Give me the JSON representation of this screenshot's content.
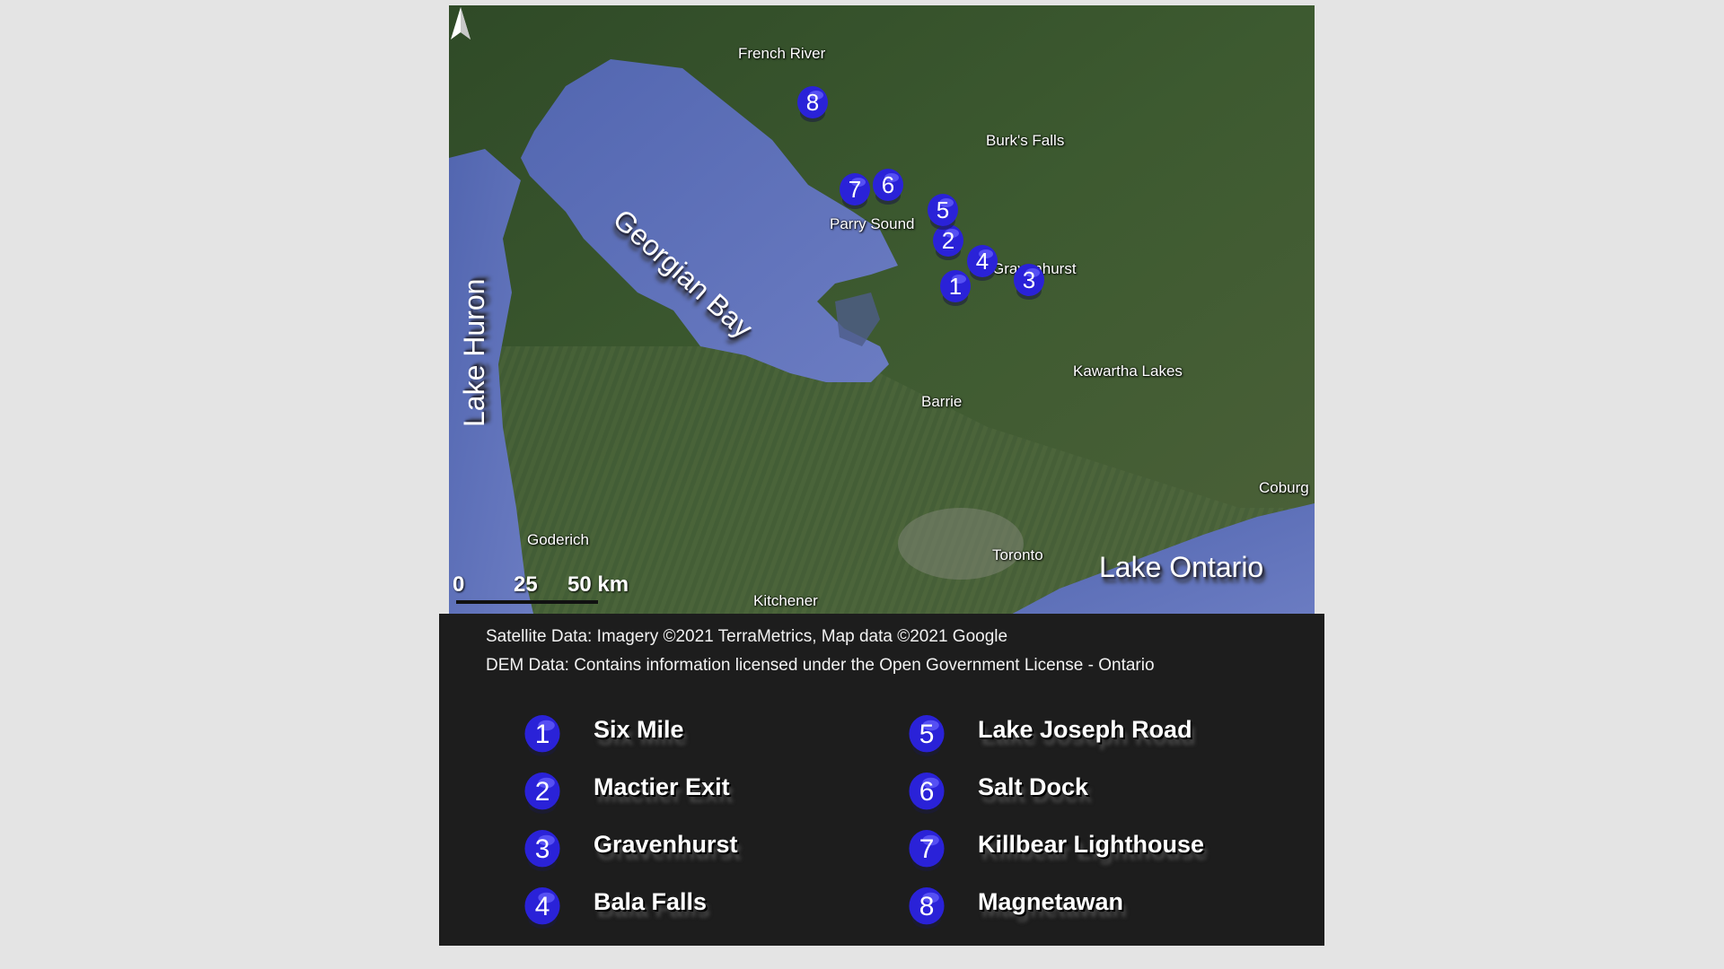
{
  "map": {
    "water_labels": {
      "georgian_bay": "Georgian Bay",
      "lake_huron": "Lake Huron",
      "lake_ontario": "Lake Ontario"
    },
    "place_labels": {
      "french_river": "French River",
      "burks_falls": "Burk's Falls",
      "parry_sound": "Parry Sound",
      "gravenhurst": "Gravenhurst",
      "kawartha_lakes": "Kawartha Lakes",
      "barrie": "Barrie",
      "coburg": "Coburg",
      "goderich": "Goderich",
      "toronto": "Toronto",
      "kitchener": "Kitchener"
    },
    "scale_bar": {
      "zero": "0",
      "mid": "25",
      "end": "50 km"
    },
    "north_arrow_icon": "north-arrow-icon",
    "colors": {
      "water": "#5a6fb8",
      "land": "#3f5b31",
      "pin": "#2a22d8",
      "legend_bg": "#1d1d1d"
    },
    "pins": [
      {
        "number": "1"
      },
      {
        "number": "2"
      },
      {
        "number": "3"
      },
      {
        "number": "4"
      },
      {
        "number": "5"
      },
      {
        "number": "6"
      },
      {
        "number": "7"
      },
      {
        "number": "8"
      }
    ]
  },
  "credits": {
    "satellite": "Satellite Data: Imagery ©2021 TerraMetrics, Map data ©2021 Google",
    "dem": "DEM Data: Contains information licensed under the Open Government License - Ontario"
  },
  "legend": {
    "items": [
      {
        "number": "1",
        "label": "Six Mile"
      },
      {
        "number": "2",
        "label": "Mactier Exit"
      },
      {
        "number": "3",
        "label": "Gravenhurst"
      },
      {
        "number": "4",
        "label": "Bala Falls"
      },
      {
        "number": "5",
        "label": "Lake Joseph Road"
      },
      {
        "number": "6",
        "label": "Salt Dock"
      },
      {
        "number": "7",
        "label": "Killbear Lighthouse"
      },
      {
        "number": "8",
        "label": "Magnetawan"
      }
    ]
  }
}
